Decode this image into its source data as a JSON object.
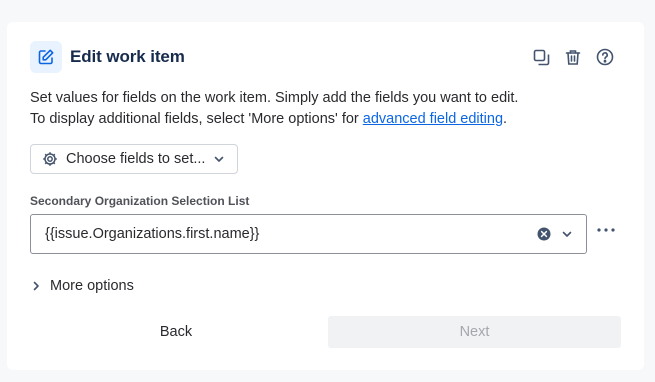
{
  "header": {
    "title": "Edit work item",
    "icon": "edit-icon",
    "actions": [
      "duplicate-icon",
      "delete-icon",
      "help-icon"
    ]
  },
  "description": {
    "line1": "Set values for fields on the work item. Simply add the fields you want to edit.",
    "line2_prefix": "To display additional fields, select 'More options' for ",
    "link_text": "advanced field editing",
    "line2_suffix": "."
  },
  "choose_fields": {
    "label": "Choose fields to set..."
  },
  "field": {
    "label": "Secondary Organization Selection List",
    "value": "{{issue.Organizations.first.name}}"
  },
  "more_options": {
    "label": "More options"
  },
  "footer": {
    "back_label": "Back",
    "next_label": "Next"
  },
  "colors": {
    "accent": "#0c66e4",
    "icon_bg": "#e9f2ff",
    "disabled_text": "#a5a7ad"
  }
}
